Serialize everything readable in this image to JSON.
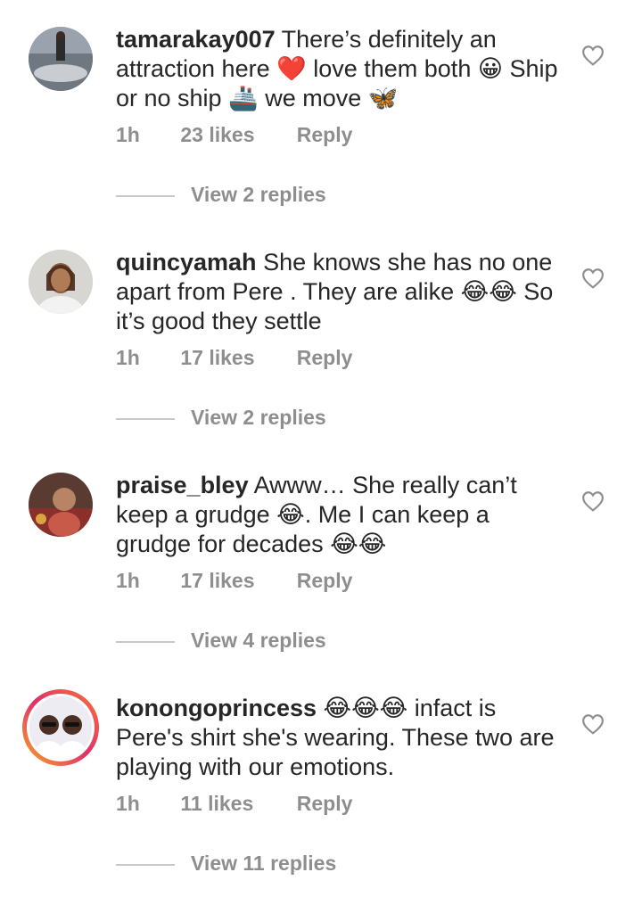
{
  "comments": [
    {
      "username": "tamarakay007",
      "text": "There’s definitely an attraction here ❤️ love them both 😀 Ship or no ship 🚢 we move 🦋",
      "time": "1h",
      "likes": "23 likes",
      "reply": "Reply",
      "view_replies": "View 2 replies"
    },
    {
      "username": "quincyamah",
      "text": "She knows she has no one apart from Pere . They are alike 😂😂 So it’s good they settle",
      "time": "1h",
      "likes": "17 likes",
      "reply": "Reply",
      "view_replies": "View 2 replies"
    },
    {
      "username": "praise_bley",
      "text": "Awww… She really can’t keep a grudge 😂. Me I can keep a grudge for decades 😂😂",
      "time": "1h",
      "likes": "17 likes",
      "reply": "Reply",
      "view_replies": "View 4 replies"
    },
    {
      "username": "konongoprincess",
      "text": "😂😂😂 infact is Pere's shirt she's wearing. These two are playing with our emotions.",
      "time": "1h",
      "likes": "11 likes",
      "reply": "Reply",
      "view_replies": "View 11 replies"
    }
  ],
  "icons": {
    "heart": "heart-outline-icon",
    "avatar_ring_colors": [
      "#f9a825",
      "#e1306c",
      "#f77737"
    ]
  }
}
